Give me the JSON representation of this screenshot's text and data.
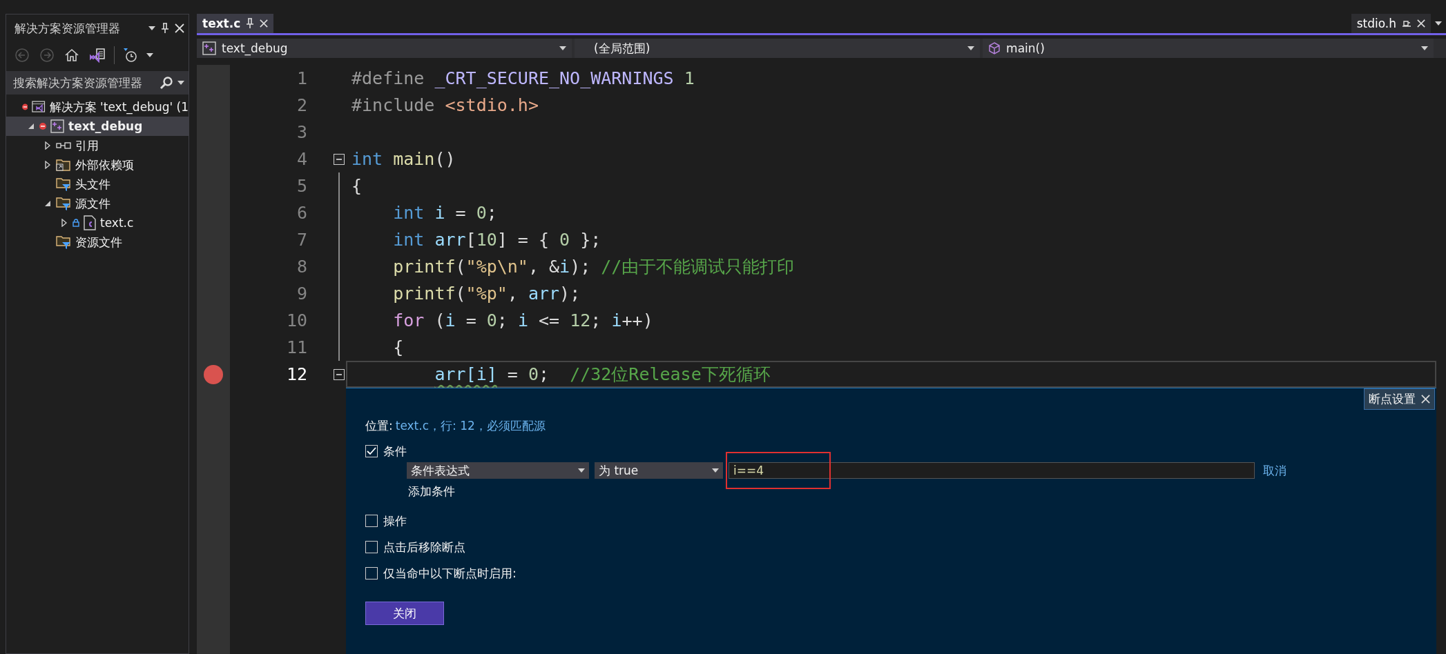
{
  "solution_explorer": {
    "title": "解决方案资源管理器",
    "toolbar": [
      {
        "kind": "back",
        "disabled": true
      },
      {
        "kind": "forward",
        "disabled": true
      },
      {
        "kind": "home",
        "disabled": false
      },
      {
        "kind": "solution-view",
        "disabled": false
      },
      {
        "kind": "history",
        "disabled": false
      }
    ],
    "search": {
      "placeholder": "搜索解决方案资源管理器"
    },
    "tree": [
      {
        "label": "解决方案 'text_debug' (1",
        "kind": "solution",
        "error_marker": true,
        "selected": false,
        "children": [
          {
            "label": "text_debug",
            "kind": "project",
            "error_marker": true,
            "selected": true,
            "expanded": true,
            "children": [
              {
                "label": "引用",
                "kind": "reference",
                "selected": false,
                "expanded": false
              },
              {
                "label": "外部依赖项",
                "kind": "external",
                "selected": false,
                "expanded": false
              },
              {
                "label": "头文件",
                "kind": "filter",
                "selected": false
              },
              {
                "label": "源文件",
                "kind": "filter",
                "selected": false,
                "expanded": true,
                "children": [
                  {
                    "label": "text.c",
                    "kind": "c-file",
                    "locked": true,
                    "selected": false,
                    "expanded": false
                  }
                ]
              },
              {
                "label": "资源文件",
                "kind": "filter",
                "selected": false
              }
            ]
          }
        ]
      }
    ]
  },
  "editor": {
    "tabs": [
      {
        "label": "text.c",
        "selected": true
      }
    ],
    "preview_tab": {
      "label": "stdio.h"
    },
    "nav": {
      "project": "text_debug",
      "scope": "(全局范围)",
      "member": "main()"
    },
    "lines": [
      {
        "number": "1",
        "breakpoint": false,
        "current": false,
        "collapsible": false,
        "in_block": false,
        "tokens": [
          {
            "kind": "pre",
            "text": "#define"
          },
          {
            "kind": "macro",
            "text": " _CRT_SECURE_NO_WARNINGS"
          },
          {
            "kind": "num",
            "text": " 1"
          }
        ]
      },
      {
        "number": "2",
        "breakpoint": false,
        "current": false,
        "collapsible": false,
        "in_block": false,
        "tokens": [
          {
            "kind": "pre",
            "text": "#include"
          },
          {
            "kind": "header",
            "text": " <stdio.h>"
          }
        ]
      },
      {
        "number": "3",
        "breakpoint": false,
        "current": false,
        "collapsible": false,
        "in_block": false
      },
      {
        "number": "4",
        "breakpoint": false,
        "current": false,
        "collapsible": true,
        "in_block": false,
        "tokens": [
          {
            "kind": "kw",
            "text": "int"
          },
          {
            "kind": "fn",
            "text": " main"
          },
          {
            "kind": "plain",
            "text": "()"
          }
        ]
      },
      {
        "number": "5",
        "breakpoint": false,
        "current": false,
        "collapsible": false,
        "in_block": true,
        "tokens": [
          {
            "kind": "plain",
            "text": "{"
          }
        ]
      },
      {
        "number": "6",
        "breakpoint": false,
        "current": false,
        "collapsible": false,
        "in_block": true,
        "tokens": [
          {
            "kind": "kw",
            "text": "    int"
          },
          {
            "kind": "var",
            "text": " i"
          },
          {
            "kind": "plain",
            "text": " ="
          },
          {
            "kind": "num",
            "text": " 0"
          },
          {
            "kind": "plain",
            "text": ";"
          }
        ]
      },
      {
        "number": "7",
        "breakpoint": false,
        "current": false,
        "collapsible": false,
        "in_block": true,
        "tokens": [
          {
            "kind": "kw",
            "text": "    int"
          },
          {
            "kind": "var",
            "text": " arr"
          },
          {
            "kind": "plain",
            "text": "["
          },
          {
            "kind": "num",
            "text": "10"
          },
          {
            "kind": "plain",
            "text": "] = {"
          },
          {
            "kind": "num",
            "text": " 0"
          },
          {
            "kind": "plain",
            "text": " };"
          }
        ]
      },
      {
        "number": "8",
        "breakpoint": false,
        "current": false,
        "collapsible": false,
        "in_block": true,
        "tokens": [
          {
            "kind": "fn",
            "text": "    printf"
          },
          {
            "kind": "plain",
            "text": "("
          },
          {
            "kind": "str",
            "text": "\"%p\\n\""
          },
          {
            "kind": "plain",
            "text": ", &"
          },
          {
            "kind": "var",
            "text": "i"
          },
          {
            "kind": "plain",
            "text": ");"
          },
          {
            "kind": "comment",
            "text": " //由于不能调试只能打印"
          }
        ]
      },
      {
        "number": "9",
        "breakpoint": false,
        "current": false,
        "collapsible": false,
        "in_block": true,
        "tokens": [
          {
            "kind": "fn",
            "text": "    printf"
          },
          {
            "kind": "plain",
            "text": "("
          },
          {
            "kind": "str",
            "text": "\"%p\""
          },
          {
            "kind": "plain",
            "text": ","
          },
          {
            "kind": "var",
            "text": " arr"
          },
          {
            "kind": "plain",
            "text": ");"
          }
        ]
      },
      {
        "number": "10",
        "breakpoint": false,
        "current": false,
        "collapsible": false,
        "in_block": true,
        "tokens": [
          {
            "kind": "ctrl",
            "text": "    for"
          },
          {
            "kind": "plain",
            "text": " ("
          },
          {
            "kind": "var",
            "text": "i"
          },
          {
            "kind": "plain",
            "text": " ="
          },
          {
            "kind": "num",
            "text": " 0"
          },
          {
            "kind": "plain",
            "text": ";"
          },
          {
            "kind": "var",
            "text": " i"
          },
          {
            "kind": "plain",
            "text": " <="
          },
          {
            "kind": "num",
            "text": " 12"
          },
          {
            "kind": "plain",
            "text": ";"
          },
          {
            "kind": "var",
            "text": " i"
          },
          {
            "kind": "plain",
            "text": "++)"
          }
        ]
      },
      {
        "number": "11",
        "breakpoint": false,
        "current": false,
        "collapsible": false,
        "in_block": true,
        "tokens": [
          {
            "kind": "plain",
            "text": "    {"
          }
        ]
      },
      {
        "number": "12",
        "breakpoint": true,
        "current": true,
        "collapsible": true,
        "in_block": true,
        "tokens": [
          {
            "kind": "warning",
            "text": "        arr[i]"
          },
          {
            "kind": "plain",
            "text": " ="
          },
          {
            "kind": "num",
            "text": " 0"
          },
          {
            "kind": "plain",
            "text": ";"
          },
          {
            "kind": "comment",
            "text": "  //32位Release下死循环"
          }
        ]
      }
    ]
  },
  "breakpoint_settings": {
    "title": "断点设置",
    "location_label": "位置:",
    "location": "text.c，行: 12，必须匹配源",
    "condition": {
      "label": "条件",
      "checked": true,
      "type": "条件表达式",
      "mode": "为 true",
      "expression": "i==4",
      "highlighted": true,
      "cancel": "取消",
      "add": "添加条件"
    },
    "options": [
      {
        "label": "操作",
        "checked": false
      },
      {
        "label": "点击后移除断点",
        "checked": false
      },
      {
        "label": "仅当命中以下断点时启用:",
        "checked": false
      }
    ],
    "close": "关闭"
  }
}
